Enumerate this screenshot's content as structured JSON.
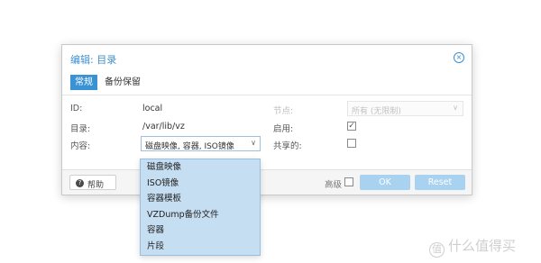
{
  "dialog": {
    "title": "编辑: 目录",
    "close_icon": "×",
    "tabs": [
      {
        "label": "常规",
        "active": true
      },
      {
        "label": "备份保留",
        "active": false
      }
    ]
  },
  "form": {
    "id_label": "ID:",
    "id_value": "local",
    "dir_label": "目录:",
    "dir_value": "/var/lib/vz",
    "content_label": "内容:",
    "content_value": "磁盘映像, 容器, ISO镜像",
    "node_label": "节点:",
    "node_value": "所有 (无限制)",
    "enable_label": "启用:",
    "enable_checked": true,
    "shared_label": "共享的:",
    "shared_checked": false
  },
  "footer": {
    "help_label": "帮助",
    "advanced_label": "高级",
    "ok_label": "OK",
    "reset_label": "Reset"
  },
  "dropdown": {
    "items": [
      "磁盘映像",
      "ISO镜像",
      "容器模板",
      "VZDump备份文件",
      "容器",
      "片段"
    ]
  },
  "watermark": {
    "icon": "值",
    "text": "什么值得买"
  },
  "colors": {
    "accent": "#3892d3",
    "title": "#3e8fcf",
    "button_disabled": "#a9d2f0",
    "dropdown_bg": "#c6def2"
  }
}
